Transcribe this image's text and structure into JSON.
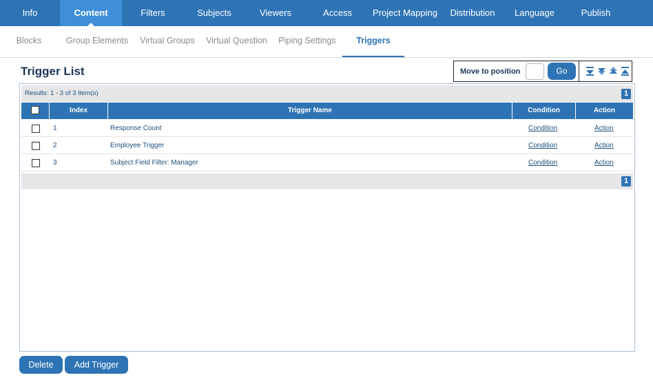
{
  "topnav": {
    "items": [
      {
        "label": "Info"
      },
      {
        "label": "Content"
      },
      {
        "label": "Filters"
      },
      {
        "label": "Subjects"
      },
      {
        "label": "Viewers"
      },
      {
        "label": "Access"
      },
      {
        "label": "Project Mapping"
      },
      {
        "label": "Distribution"
      },
      {
        "label": "Language"
      },
      {
        "label": "Publish"
      }
    ],
    "active": "Content"
  },
  "subnav": {
    "items": [
      {
        "label": "Blocks"
      },
      {
        "label": "Group Elements"
      },
      {
        "label": "Virtual Groups"
      },
      {
        "label": "Virtual Question"
      },
      {
        "label": "Piping Settings"
      },
      {
        "label": "Triggers"
      }
    ],
    "active": "Triggers"
  },
  "page": {
    "title": "Trigger List"
  },
  "move": {
    "label": "Move to position",
    "input_value": "",
    "go_label": "Go"
  },
  "arrows": [
    "move-to-bottom-icon",
    "move-down-icon",
    "move-up-icon",
    "move-to-top-icon"
  ],
  "grid": {
    "results_text": "Results: 1 - 3 of 3 Item(s)",
    "page_top": "1",
    "page_bottom": "1",
    "columns": {
      "index": "Index",
      "name": "Trigger Name",
      "condition": "Condition",
      "action": "Action"
    },
    "rows": [
      {
        "index": "1",
        "name": "Response Count",
        "condition": "Condition",
        "action": "Action"
      },
      {
        "index": "2",
        "name": "Employee Trigger",
        "condition": "Condition",
        "action": "Action"
      },
      {
        "index": "3",
        "name": "Subject Field Filter: Manager",
        "condition": "Condition",
        "action": "Action"
      }
    ]
  },
  "buttons": {
    "delete": "Delete",
    "add": "Add Trigger"
  },
  "colors": {
    "primary": "#2e74b5",
    "active_tab": "#3f8fd8",
    "title": "#1d3557"
  }
}
